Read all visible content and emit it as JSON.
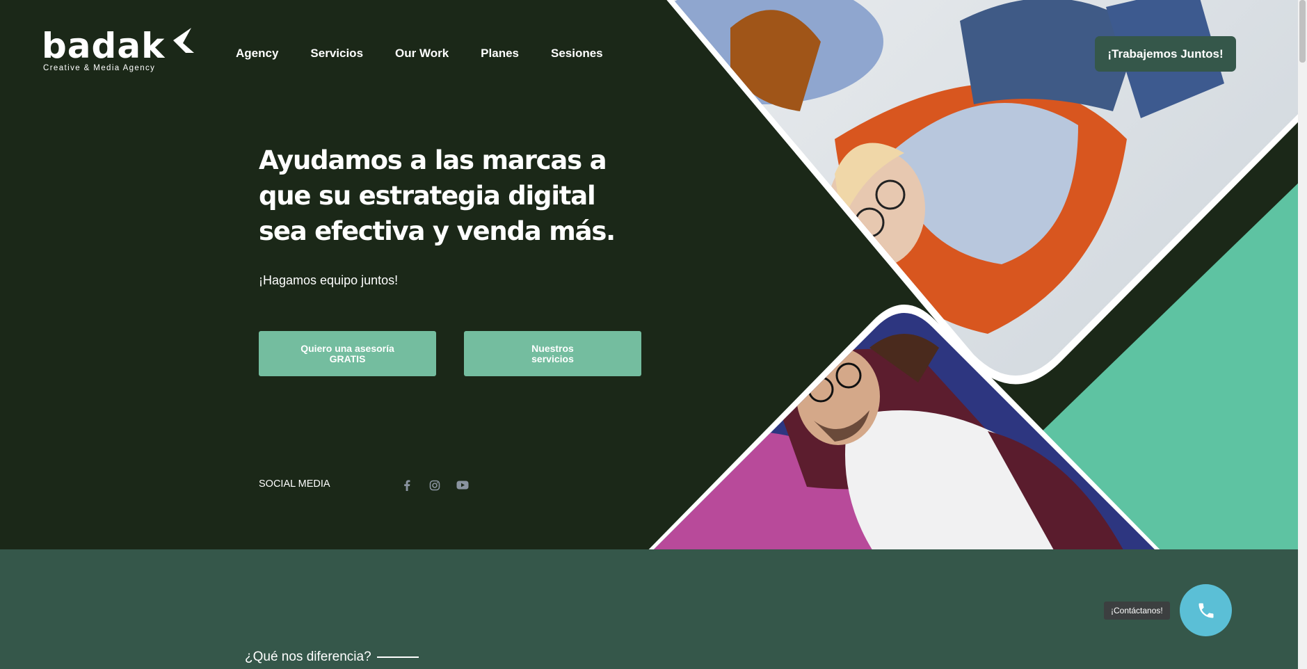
{
  "brand": {
    "name": "badak",
    "tagline": "Creative & Media Agency"
  },
  "nav": {
    "items": [
      "Agency",
      "Servicios",
      "Our Work",
      "Planes",
      "Sesiones"
    ]
  },
  "header": {
    "cta_label": "¡Trabajemos Juntos!"
  },
  "hero": {
    "headline": "Ayudamos a las marcas a que su estrategia digital sea efectiva y venda más.",
    "subheadline": "¡Hagamos equipo juntos!",
    "btn_primary": "Quiero una asesoría GRATIS",
    "btn_secondary": "Nuestros servicios",
    "social_label": "SOCIAL MEDIA",
    "social_icons": [
      "facebook-icon",
      "instagram-icon",
      "youtube-icon"
    ]
  },
  "section2": {
    "title": "¿Qué nos diferencia?"
  },
  "contact": {
    "tooltip": "¡Contáctanos!",
    "icon": "phone-icon"
  },
  "colors": {
    "hero_bg": "#1b2818",
    "accent_green": "#74bd9f",
    "section_bg": "#35574a",
    "mint": "#5ec3a2",
    "phone_btn": "#5bbfd6"
  }
}
